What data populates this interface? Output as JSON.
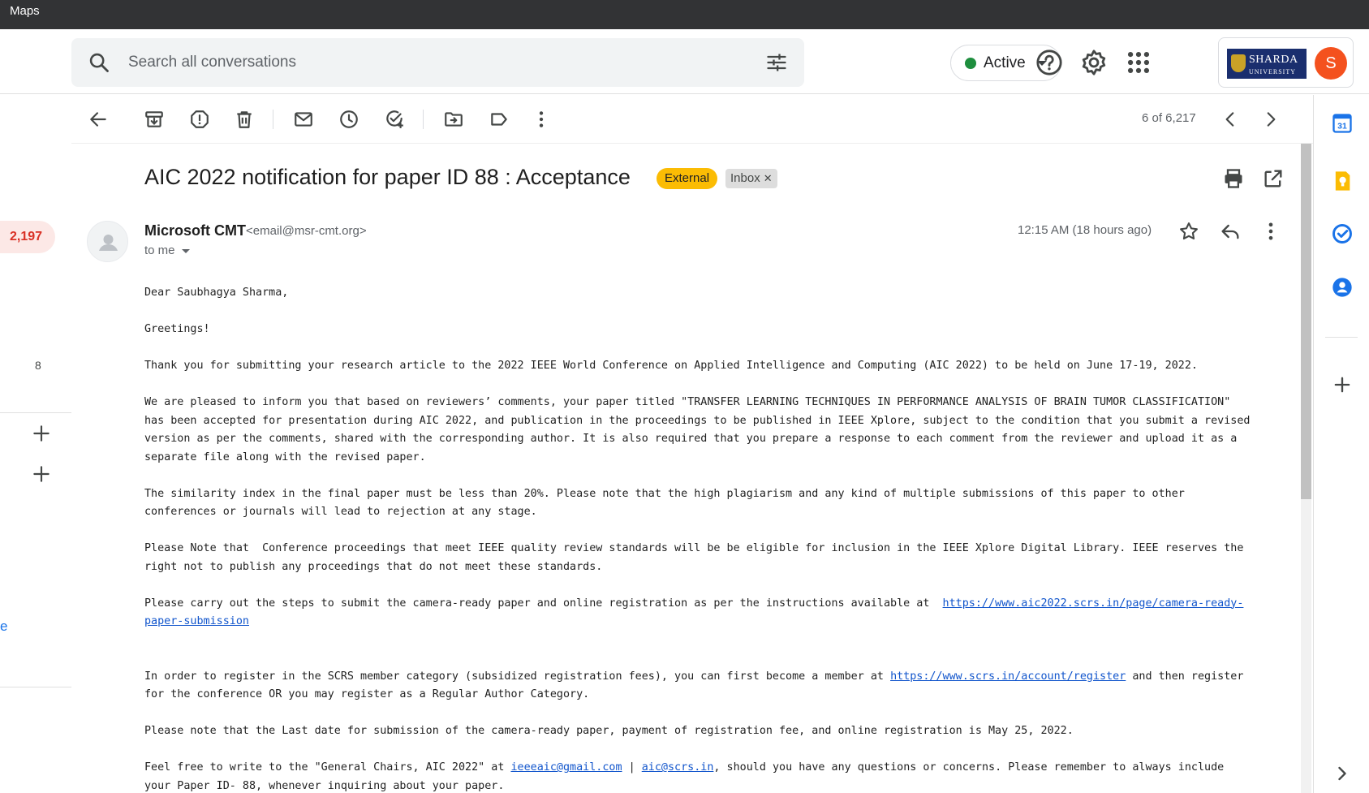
{
  "window": {
    "title": "Maps"
  },
  "search": {
    "placeholder": "Search all conversations"
  },
  "status": {
    "label": "Active",
    "color": "#1e8e3e"
  },
  "account": {
    "org_line1": "SHARDA",
    "org_line2": "UNIVERSITY",
    "avatar_letter": "S"
  },
  "left_rail": {
    "unread_badge": "2,197",
    "count": "8",
    "partial_link": "e"
  },
  "toolbar": {
    "page_counter": "6 of 6,217"
  },
  "email": {
    "subject": "AIC 2022 notification for paper ID 88 : Acceptance",
    "label_external": "External",
    "label_inbox": "Inbox",
    "sender_name": "Microsoft CMT",
    "sender_email": "<email@msr-cmt.org>",
    "recipient": "to me",
    "time": "12:15 AM (18 hours ago)",
    "body": {
      "greeting": "Dear Saubhagya Sharma,",
      "greetings": "Greetings!",
      "p1": "Thank you for submitting your research article to the 2022 IEEE World Conference on Applied Intelligence and Computing (AIC 2022) to be held on June 17-19, 2022.",
      "p2": "We are pleased to inform you that based on reviewers’ comments, your paper titled \"TRANSFER LEARNING TECHNIQUES IN PERFORMANCE ANALYSIS OF BRAIN TUMOR CLASSIFICATION\"\nhas been accepted for presentation during AIC 2022, and publication in the proceedings to be published in IEEE Xplore, subject to the condition that you submit a revised\nversion as per the comments, shared with the corresponding author. It is also required that you prepare a response to each comment from the reviewer and upload it as a\nseparate file along with the revised paper.",
      "p3": "The similarity index in the final paper must be less than 20%. Please note that the high plagiarism and any kind of multiple submissions of this paper to other\nconferences or journals will lead to rejection at any stage.",
      "p4": "Please Note that  Conference proceedings that meet IEEE quality review standards will be be eligible for inclusion in the IEEE Xplore Digital Library. IEEE reserves the\nright not to publish any proceedings that do not meet these standards.",
      "p5_text": "Please carry out the steps to submit the camera-ready paper and online registration as per the instructions available at  ",
      "p5_link1": "https://www.aic2022.scrs.in/page/camera-ready-",
      "p5_link2": "paper-submission",
      "p6_pre": "In order to register in the SCRS member category (subsidized registration fees), you can first become a member at ",
      "p6_link": "https://www.scrs.in/account/register",
      "p6_post": " and then register\nfor the conference OR you may register as a Regular Author Category.",
      "p7": "Please note that the Last date for submission of the camera-ready paper, payment of registration fee, and online registration is May 25, 2022.",
      "p8_pre": "Feel free to write to the \"General Chairs, AIC 2022\" at ",
      "p8_link1": "ieeeaic@gmail.com",
      "p8_sep": " | ",
      "p8_link2": "aic@scrs.in",
      "p8_post": ", should you have any questions or concerns. Please remember to always include\nyour Paper ID- 88, whenever inquiring about your paper."
    }
  },
  "colors": {
    "external_label": "#fbbc04",
    "unread_badge": "#d93025",
    "link": "#1155cc",
    "avatar": "#f4511e"
  }
}
